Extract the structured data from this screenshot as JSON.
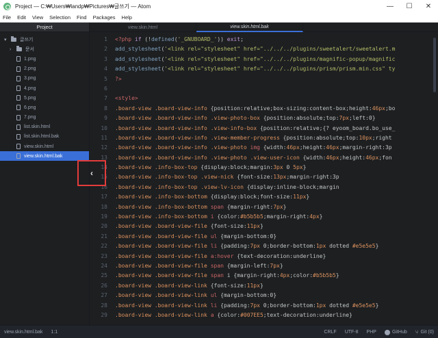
{
  "window": {
    "title": "Project — C:₩Users₩landp₩Pictures₩글쓰기 — Atom",
    "minimize": "—",
    "maximize": "☐",
    "close": "✕"
  },
  "menu": [
    "File",
    "Edit",
    "View",
    "Selection",
    "Find",
    "Packages",
    "Help"
  ],
  "tree": {
    "header": "Project",
    "root": "글쓰기",
    "folder": "문서",
    "files": [
      "1.png",
      "2.png",
      "3.png",
      "4.png",
      "5.png",
      "6.png",
      "7.png",
      "list.skin.html",
      "list.skin.html.bak",
      "view.skin.html",
      "view.skin.html.bak"
    ],
    "selected_index": 10
  },
  "tabs": [
    {
      "label": "view.skin.html",
      "active": false
    },
    {
      "label": "view.skin.html.bak",
      "active": true
    }
  ],
  "editor": {
    "line_numbers": [
      "1",
      "2",
      "3",
      "4",
      "5",
      "6",
      "7",
      "8",
      "9",
      "10",
      "11",
      "12",
      "13",
      "14",
      "15",
      "16",
      "17",
      "18",
      "19",
      "20",
      "21",
      "22",
      "23",
      "24",
      "25",
      "26",
      "27",
      "28",
      "29"
    ],
    "lines": [
      "<?php if (!defined('_GNUBOARD_')) exit;",
      "add_stylesheet('<link rel=\"stylesheet\" href=\"../../../plugins/sweetalert/sweetalert.m",
      "add_stylesheet('<link rel=\"stylesheet\" href=\"../../../plugins/magnific-popup/magnific",
      "add_stylesheet('<link rel=\"stylesheet\" href=\"../../../plugins/prism/prism.min.css\" ty",
      "?>",
      "",
      "<style>",
      ".board-view .board-view-info {position:relative;box-sizing:content-box;height:46px;bo",
      ".board-view .board-view-info .view-photo-box {position:absolute;top:7px;left:0}",
      ".board-view .board-view-info .view-info-box {position:relative;{? eyoom_board.bo_use_",
      ".board-view .board-view-info .view-member-progress {position:absolute;top:10px;right",
      ".board-view .board-view-info .view-photo img {width:46px;height:46px;margin-right:3p",
      ".board-view .board-view-info .view-photo .view-user-icon {width:46px;height:46px;fon",
      ".board-view .info-box-top {display:block;margin:3px 0 5px}",
      ".board-view .info-box-top .view-nick {font-size:13px;margin-right:3p",
      ".board-view .info-box-top .view-lv-icon {display:inline-block;margin",
      ".board-view .info-box-bottom {display:block;font-size:11px}",
      ".board-view .info-box-bottom span {margin-right:7px}",
      ".board-view .info-box-bottom i {color:#b5b5b5;margin-right:4px}",
      ".board-view .board-view-file {font-size:11px}",
      ".board-view .board-view-file ul {margin-bottom:0}",
      ".board-view .board-view-file li {padding:7px 0;border-bottom:1px dotted #e5e5e5}",
      ".board-view .board-view-file a:hover {text-decoration:underline}",
      ".board-view .board-view-file span {margin-left:7px}",
      ".board-view .board-view-file span i {margin-right:4px;color:#b5b5b5}",
      ".board-view .board-view-link {font-size:11px}",
      ".board-view .board-view-link ul {margin-bottom:0}",
      ".board-view .board-view-link li {padding:7px 0;border-bottom:1px dotted #e5e5e5}",
      ".board-view .board-view-link a {color:#007EE5;text-decoration:underline}"
    ]
  },
  "status": {
    "file": "view.skin.html.bak",
    "cursor": "1:1",
    "line_ending": "CRLF",
    "encoding": "UTF-8",
    "grammar": "PHP",
    "github": "GitHub",
    "git": "Git (0)"
  },
  "colors": {
    "selection": "#3a6fd8",
    "highlight_box": "#e53b3b",
    "background": "#1d1f21"
  }
}
